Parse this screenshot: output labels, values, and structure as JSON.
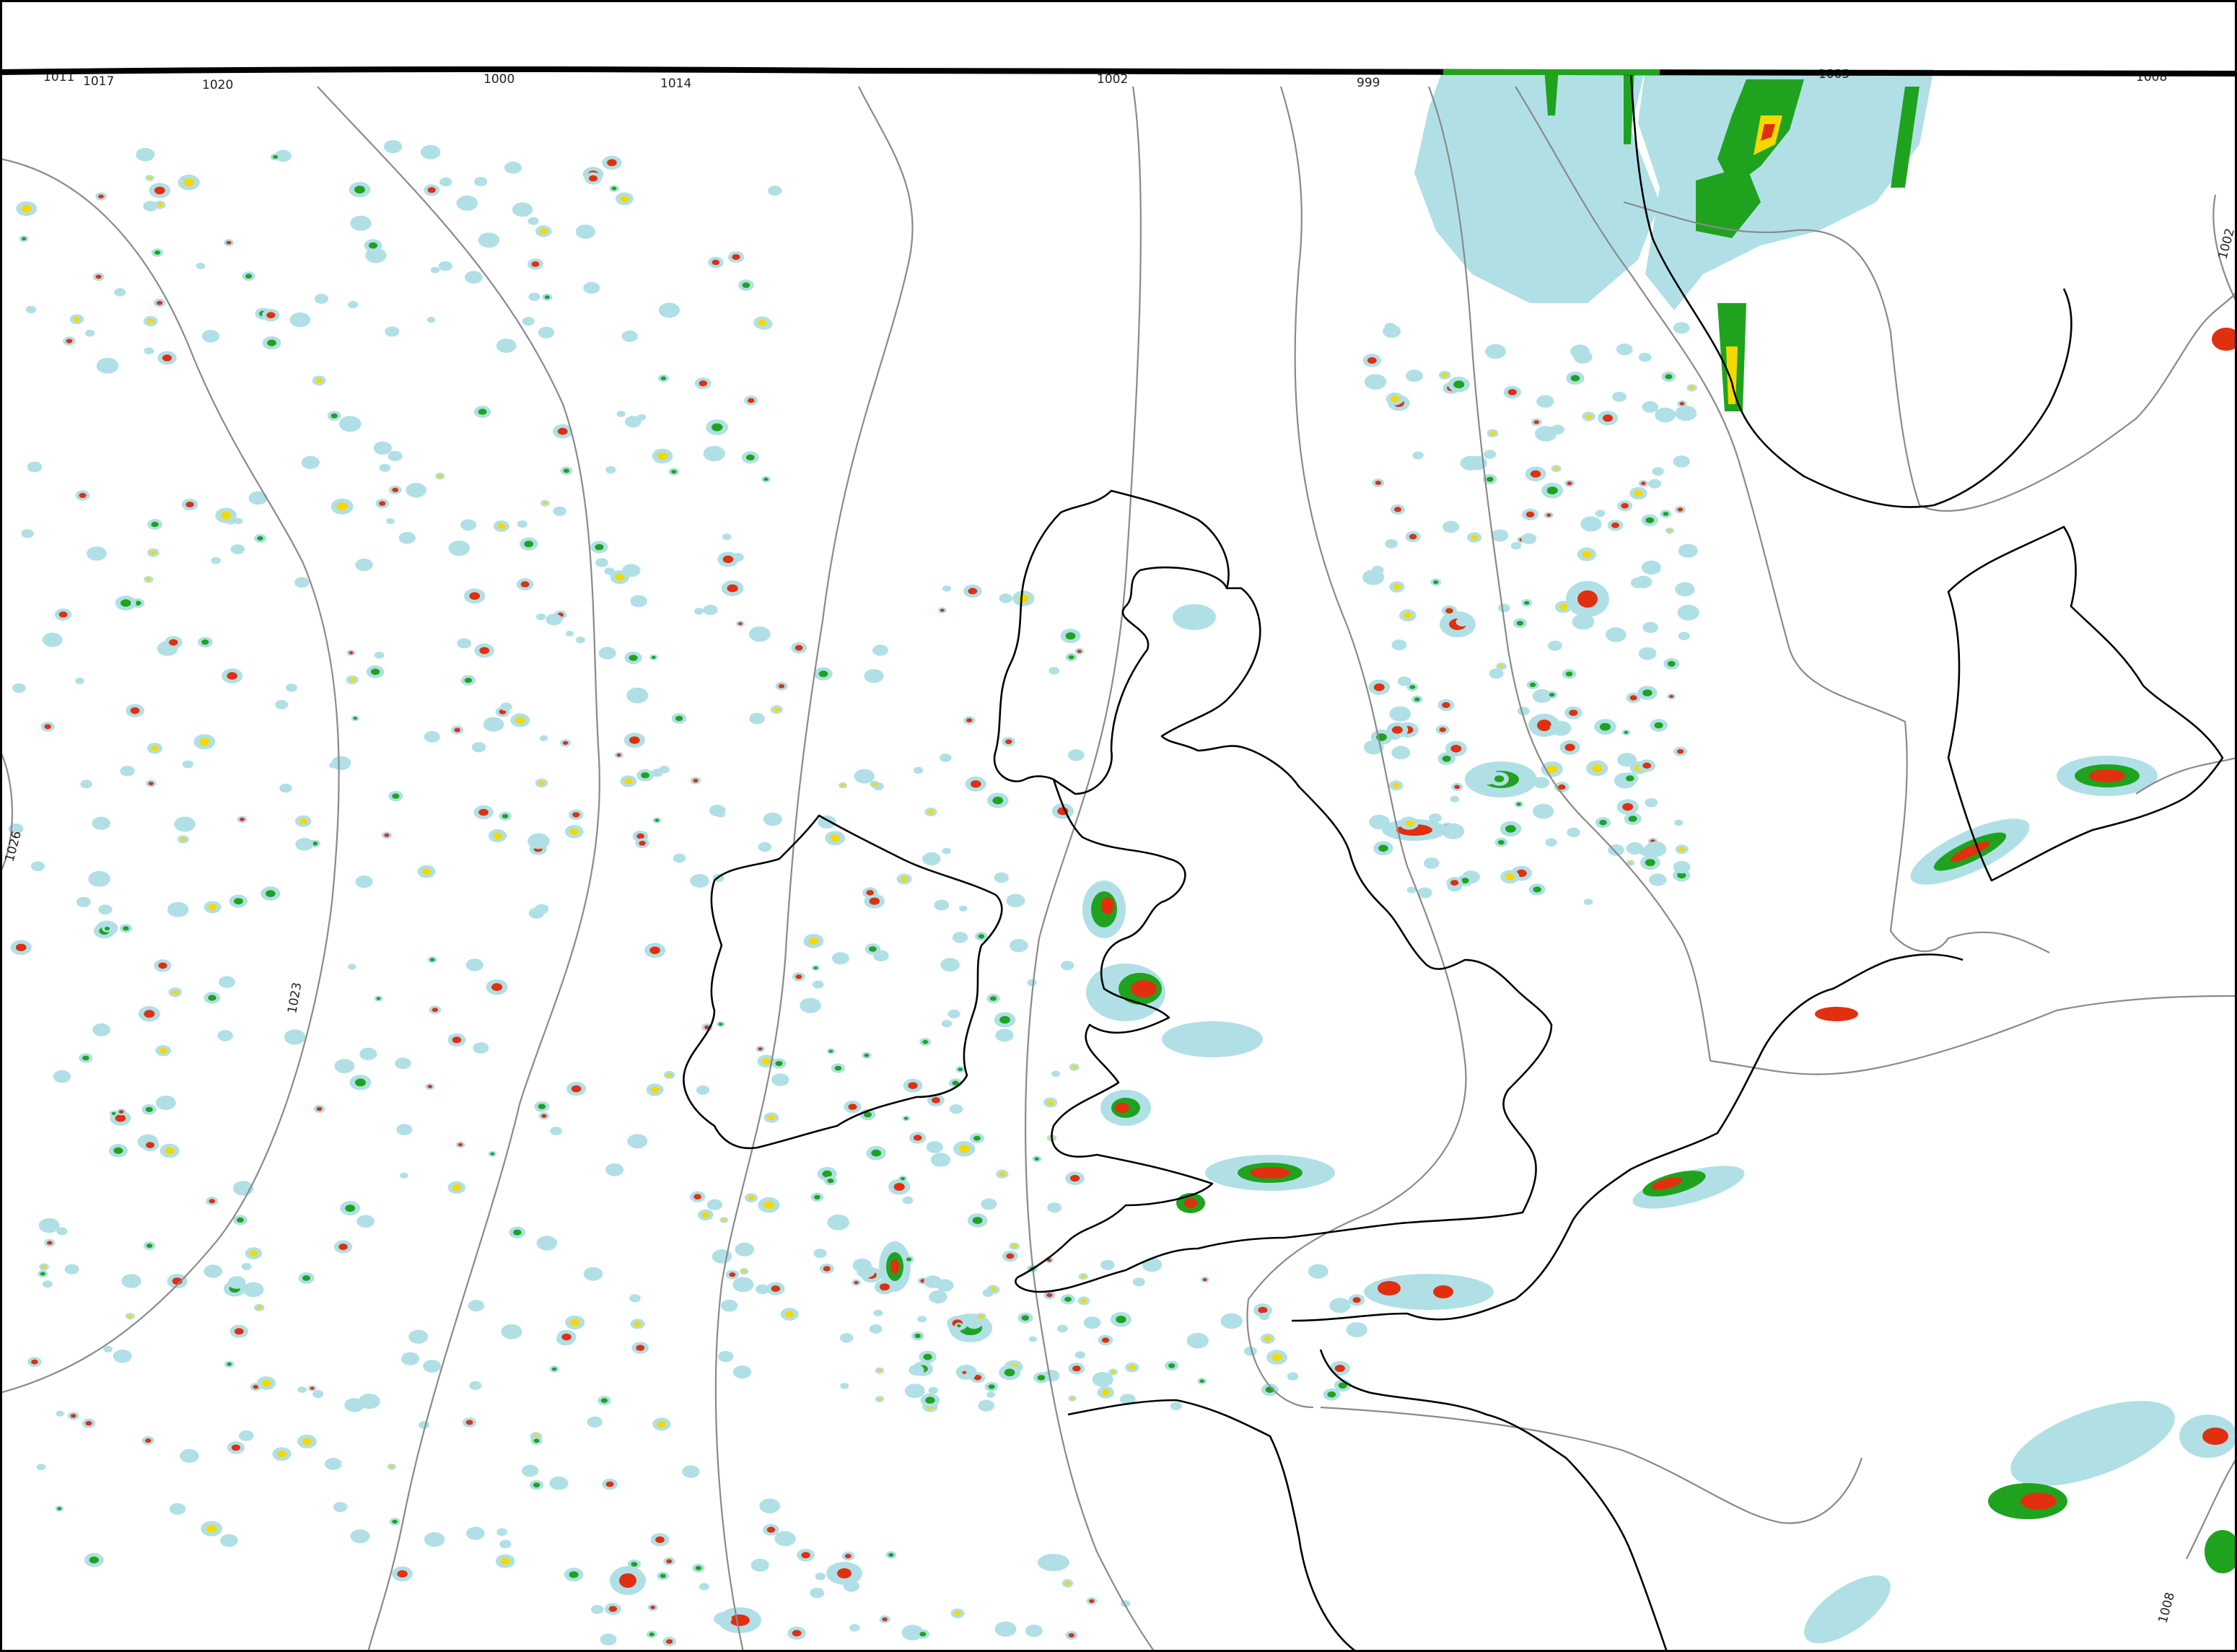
{
  "map": {
    "type": "weather-forecast-map",
    "region": "British Isles and North Sea",
    "layers": [
      "precipitation",
      "mean-sea-level-pressure-isobars",
      "coastlines"
    ],
    "colors": {
      "background": "#ffffff",
      "precip_light": "#b0e0e6",
      "precip_moderate": "#1fa31f",
      "precip_heavy": "#f5d800",
      "precip_very_heavy": "#e03010",
      "precip_extreme": "#8b0000",
      "isobar": "#8a8a8a",
      "coastline": "#000000"
    },
    "isobar_labels": [
      "1026",
      "1023",
      "1020",
      "1017",
      "1014",
      "1011",
      "1008",
      "1005",
      "1002",
      "999"
    ],
    "top_edge_labels": [
      "1011",
      "1017",
      "1020",
      "1000",
      "1014",
      "1002",
      "999",
      "1005",
      "1008"
    ]
  }
}
